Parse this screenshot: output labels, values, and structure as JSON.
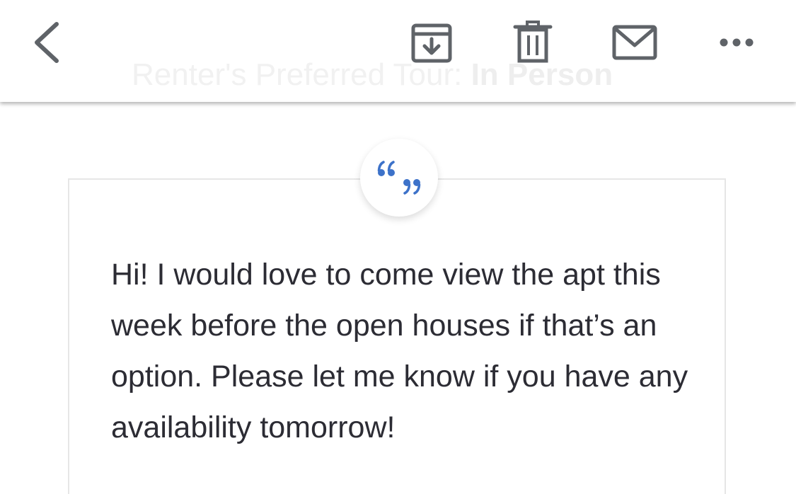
{
  "header": {
    "ghost_text_prefix": "Renter's Preferred Tour: ",
    "ghost_text_value": "In Person"
  },
  "toolbar": {
    "back_icon": "chevron-left-icon",
    "archive_icon": "archive-icon",
    "delete_icon": "trash-icon",
    "mail_icon": "mail-icon",
    "more_icon": "more-horizontal-icon"
  },
  "message": {
    "quote_icon": "quote-icon",
    "text": "Hi! I would love to come view the apt this week before the open houses if that’s an option. Please let me know if you have any availability tomorrow!"
  },
  "colors": {
    "icon": "#5f6368",
    "quote_accent": "#3d72c9",
    "text": "#2c2c34",
    "card_border": "#e6e6e6"
  }
}
